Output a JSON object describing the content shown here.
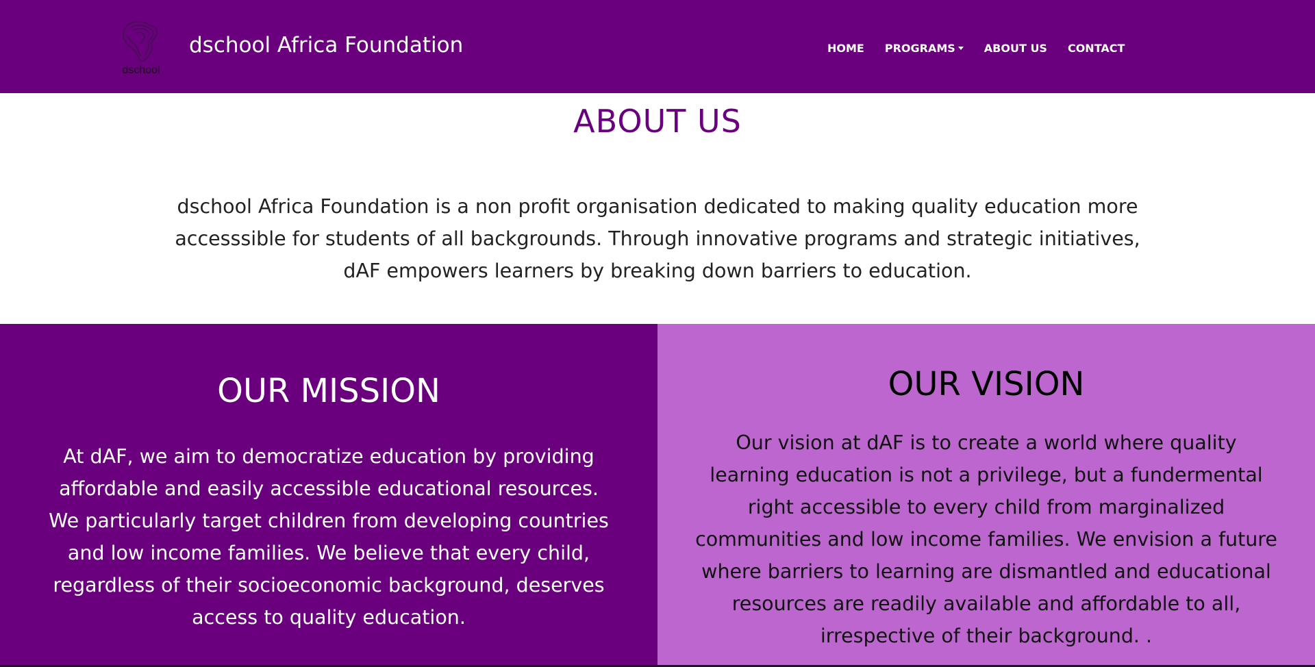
{
  "header": {
    "logo_text": "dschool",
    "brand_title": "dschool Africa Foundation",
    "nav": {
      "home": "HOME",
      "programs": "PROGRAMS",
      "about": "ABOUT US",
      "contact": "CONTACT"
    }
  },
  "about": {
    "title": "ABOUT US",
    "text": "dschool Africa Foundation is a non profit organisation dedicated to making quality education more accesssible for students of all backgrounds. Through innovative programs and strategic initiatives, dAF empowers learners by breaking down barriers to education."
  },
  "mission": {
    "title": "OUR MISSION",
    "text": "At dAF, we aim to democratize education by providing affordable and easily accessible educational resources. We particularly target children from developing countries and low income families. We believe that every child, regardless of their socioeconomic background, deserves access to quality education."
  },
  "vision": {
    "title": "OUR VISION",
    "text": "Our vision at dAF is to create a world where quality learning education is not a privilege, but a fundermental right accessible to every child from marginalized communities and low income families. We envision a future where barriers to learning are dismantled and educational resources are readily available and affordable to all, irrespective of their background. ."
  },
  "colors": {
    "primary": "#6a007d",
    "vision_bg": "#bd66d0",
    "text_dark": "#222222"
  }
}
